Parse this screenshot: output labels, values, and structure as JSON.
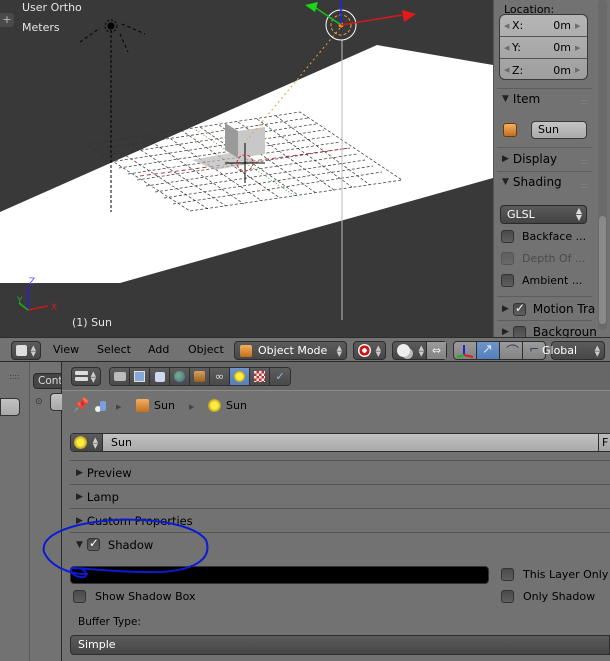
{
  "viewport": {
    "view_name": "User Ortho",
    "units": "Meters",
    "active_object": "(1) Sun",
    "axis_labels": {
      "x": "X",
      "y": "Y",
      "z": "Z"
    }
  },
  "npanel": {
    "location_label": "Location:",
    "location": [
      {
        "axis": "X:",
        "value": "0m"
      },
      {
        "axis": "Y:",
        "value": "0m"
      },
      {
        "axis": "Z:",
        "value": "0m"
      }
    ],
    "item_header": "Item",
    "item_name": "Sun",
    "display_header": "Display",
    "shading_header": "Shading",
    "shading_mode": "GLSL",
    "shading_options": [
      {
        "label": "Backface ...",
        "checked": false,
        "enabled": true
      },
      {
        "label": "Depth Of ...",
        "checked": false,
        "enabled": false
      },
      {
        "label": "Ambient ...",
        "checked": false,
        "enabled": true
      }
    ],
    "motion_tracking_label": "Motion Tra",
    "motion_tracking_checked": true,
    "background_label": "Backgroun"
  },
  "toolbar": {
    "menus": [
      "View",
      "Select",
      "Add",
      "Object"
    ],
    "mode": "Object Mode",
    "orientation": "Global"
  },
  "left_strip": {
    "tab_label": "Cont"
  },
  "properties": {
    "context_tabs": [
      {
        "name": "render",
        "icon": "camera-icon",
        "active": false
      },
      {
        "name": "render-layers",
        "icon": "render-layers-icon",
        "active": false
      },
      {
        "name": "scene",
        "icon": "scene-icon",
        "active": false
      },
      {
        "name": "world",
        "icon": "world-icon",
        "active": false
      },
      {
        "name": "object",
        "icon": "object-icon",
        "active": false
      },
      {
        "name": "constraints",
        "icon": "constraints-icon",
        "active": false
      },
      {
        "name": "data",
        "icon": "lamp-icon",
        "active": true
      },
      {
        "name": "texture",
        "icon": "texture-icon",
        "active": false
      },
      {
        "name": "physics",
        "icon": "physics-icon",
        "active": false
      }
    ],
    "breadcrumb": [
      "Sun",
      "Sun"
    ],
    "datablock_name": "Sun",
    "datablock_fake_user": "F",
    "panels": [
      {
        "label": "Preview",
        "expanded": false
      },
      {
        "label": "Lamp",
        "expanded": false
      },
      {
        "label": "Custom Properties",
        "expanded": false
      },
      {
        "label": "Shadow",
        "expanded": true,
        "checked": true
      }
    ],
    "shadow": {
      "this_layer_only": "This Layer Only",
      "this_layer_only_checked": false,
      "only_shadow": "Only Shadow",
      "only_shadow_checked": false,
      "show_shadow_box": "Show Shadow Box",
      "show_shadow_box_checked": false,
      "buffer_type_label": "Buffer Type:",
      "buffer_type": "Simple"
    }
  },
  "colors": {
    "viewport_bg": "#393939",
    "panel_bg": "#727272",
    "active_tab": "#5680bb",
    "annotation": "#0a1bd8",
    "axis_x": "#d42020",
    "axis_y": "#20b020",
    "axis_z": "#2020d8"
  }
}
